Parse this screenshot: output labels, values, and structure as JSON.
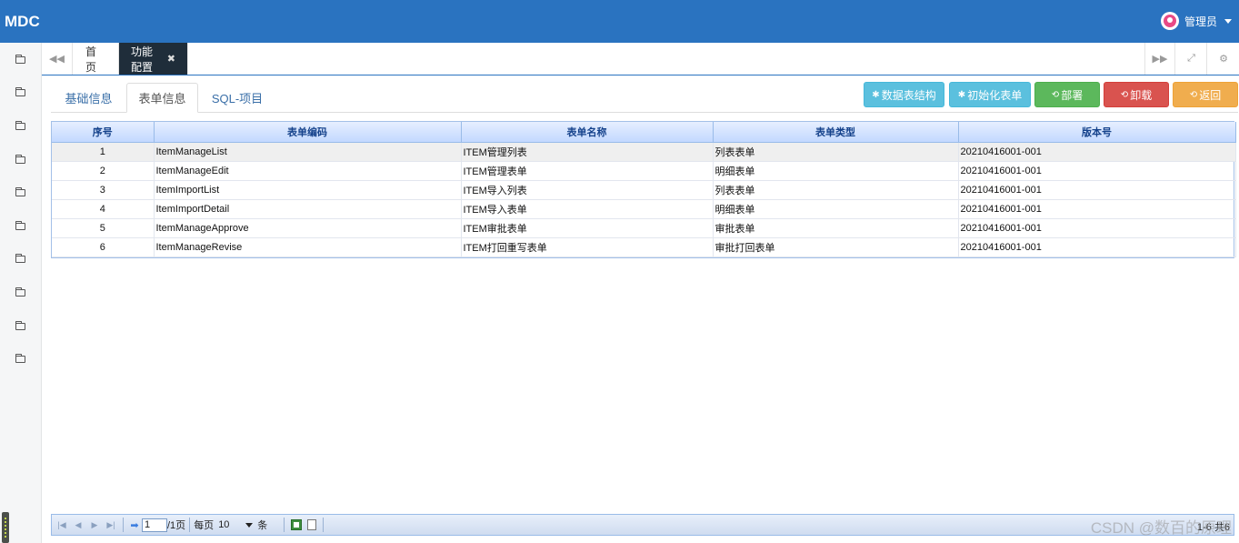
{
  "app": {
    "title": "MDC",
    "user": "管理员"
  },
  "sidebar": {
    "items": [
      "folder-icon",
      "folder-icon",
      "folder-icon",
      "folder-icon",
      "folder-icon",
      "folder-icon",
      "folder-icon",
      "folder-icon",
      "folder-icon",
      "folder-icon"
    ]
  },
  "tabs": {
    "home": "首页",
    "active": "功能配置",
    "close": "✖"
  },
  "subtabs": {
    "basic": "基础信息",
    "form": "表单信息",
    "sql": "SQL-项目"
  },
  "buttons": {
    "table_structure": "数据表结构",
    "init_form": "初始化表单",
    "deploy": "部署",
    "uninstall": "卸载",
    "back": "返回"
  },
  "grid": {
    "columns": [
      "序号",
      "表单编码",
      "表单名称",
      "表单类型",
      "版本号"
    ],
    "rows": [
      [
        "1",
        "ItemManageList",
        "ITEM管理列表",
        "列表表单",
        "20210416001-001"
      ],
      [
        "2",
        "ItemManageEdit",
        "ITEM管理表单",
        "明细表单",
        "20210416001-001"
      ],
      [
        "3",
        "ItemImportList",
        "ITEM导入列表",
        "列表表单",
        "20210416001-001"
      ],
      [
        "4",
        "ItemImportDetail",
        "ITEM导入表单",
        "明细表单",
        "20210416001-001"
      ],
      [
        "5",
        "ItemManageApprove",
        "ITEM审批表单",
        "审批表单",
        "20210416001-001"
      ],
      [
        "6",
        "ItemManageRevise",
        "ITEM打回重写表单",
        "审批打回表单",
        "20210416001-001"
      ]
    ]
  },
  "pager": {
    "page": "1",
    "total_pages": "/1页",
    "per_page_label": "每页",
    "per_page": "10",
    "unit": "条",
    "info": "1-6 共6"
  },
  "watermark": "CSDN @数百的原理"
}
